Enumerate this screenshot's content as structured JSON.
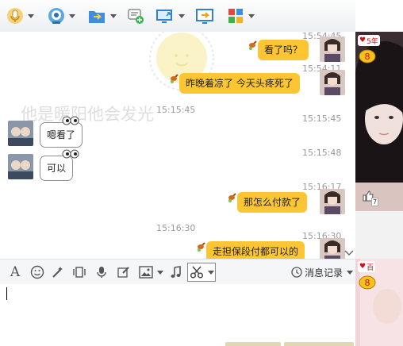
{
  "toolbar": {
    "icons": [
      "microphone-icon",
      "webcam-icon",
      "folder-transfer-icon",
      "message-add-icon",
      "screen-share-icon",
      "remote-assist-icon",
      "apps-grid-icon"
    ]
  },
  "chat": {
    "watermark": "他是暖阳他会发光",
    "messages": [
      {
        "side": "out",
        "time": "15:54:45",
        "text": "看了吗？"
      },
      {
        "side": "out",
        "time": "15:54:11",
        "text": "昨晚着凉了  今天头疼死了"
      },
      {
        "side": "in",
        "time": "15:15:45",
        "text": "嗯看了"
      },
      {
        "side": "in",
        "time": "15:15:48",
        "text": "可以"
      },
      {
        "side": "out",
        "time": "15:16:17",
        "text": "那怎么付款了"
      },
      {
        "side": "out",
        "time": "15:16:30",
        "text": "走担保段付都可以的"
      }
    ],
    "extra_times": [
      "15:15:45",
      "15:16:30"
    ]
  },
  "inputbar": {
    "history_label": "消息记录"
  },
  "right": {
    "badge_top": "VIP",
    "badge_top_text": "5年",
    "badge_bottom_text": "百",
    "counter": "7"
  },
  "colors": {
    "bubble_out": "#fbc533",
    "bubble_in_border": "#8e8e8e",
    "time_text": "#9a9a9a",
    "toolbar_bg": "#eceff3"
  }
}
